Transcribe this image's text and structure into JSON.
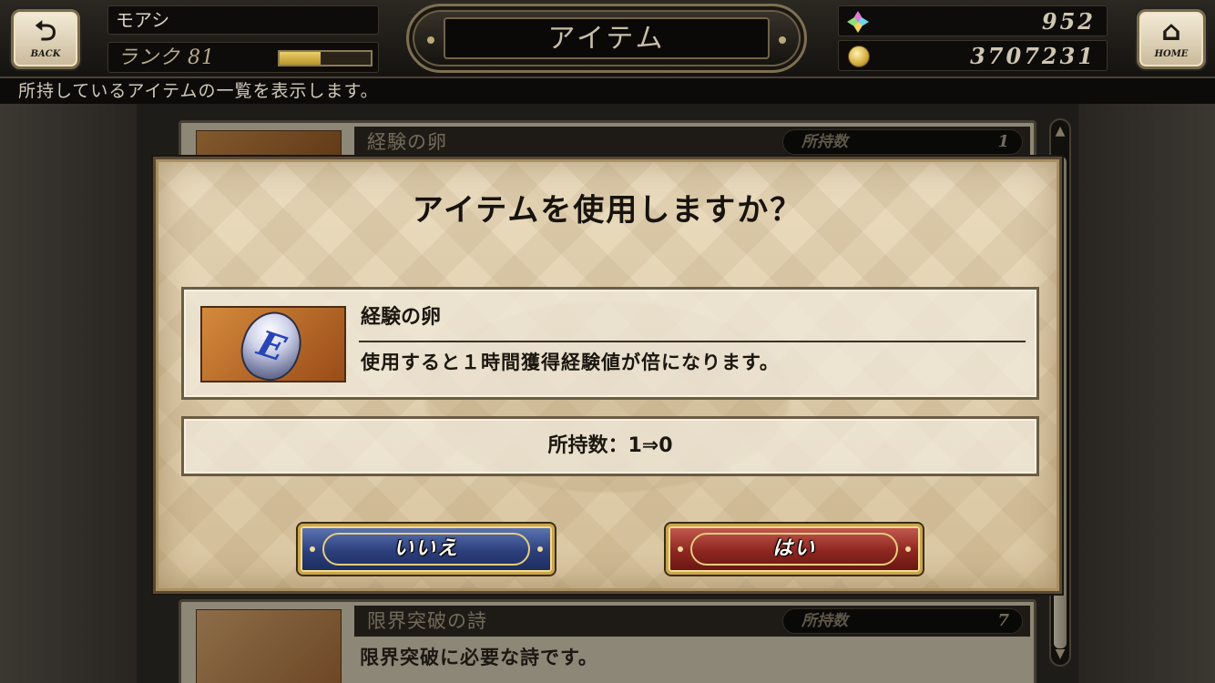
{
  "header": {
    "back_label": "BACK",
    "home_label": "HOME",
    "player_name": "モアシ",
    "rank_text": "ランク 81",
    "rank_exp_progress": 0.45,
    "screen_title": "アイテム",
    "gems": "952",
    "gil": "3707231",
    "subtitle": "所持しているアイテムの一覧を表示します。"
  },
  "icons": {
    "back": "back-arrow-icon",
    "home": "home-icon",
    "gem": "crystal-gem-icon",
    "gil": "gold-coin-icon"
  },
  "list": {
    "items": [
      {
        "name": "経験の卵",
        "count_label": "所持数",
        "count": "1",
        "desc": ""
      },
      {
        "name": "限界突破の詩",
        "count_label": "所持数",
        "count": "7",
        "desc": "限界突破に必要な詩です。"
      }
    ]
  },
  "dialog": {
    "title": "アイテムを使用しますか？",
    "item_name": "経験の卵",
    "item_desc": "使用すると１時間獲得経験値が倍になります。",
    "item_icon_letter": "E",
    "count_text": "所持数：1⇒0",
    "no_label": "いいえ",
    "yes_label": "はい"
  },
  "colors": {
    "no_button": "#2c3f7c",
    "yes_button": "#8e2620",
    "frame_gold": "#c9a54a"
  }
}
